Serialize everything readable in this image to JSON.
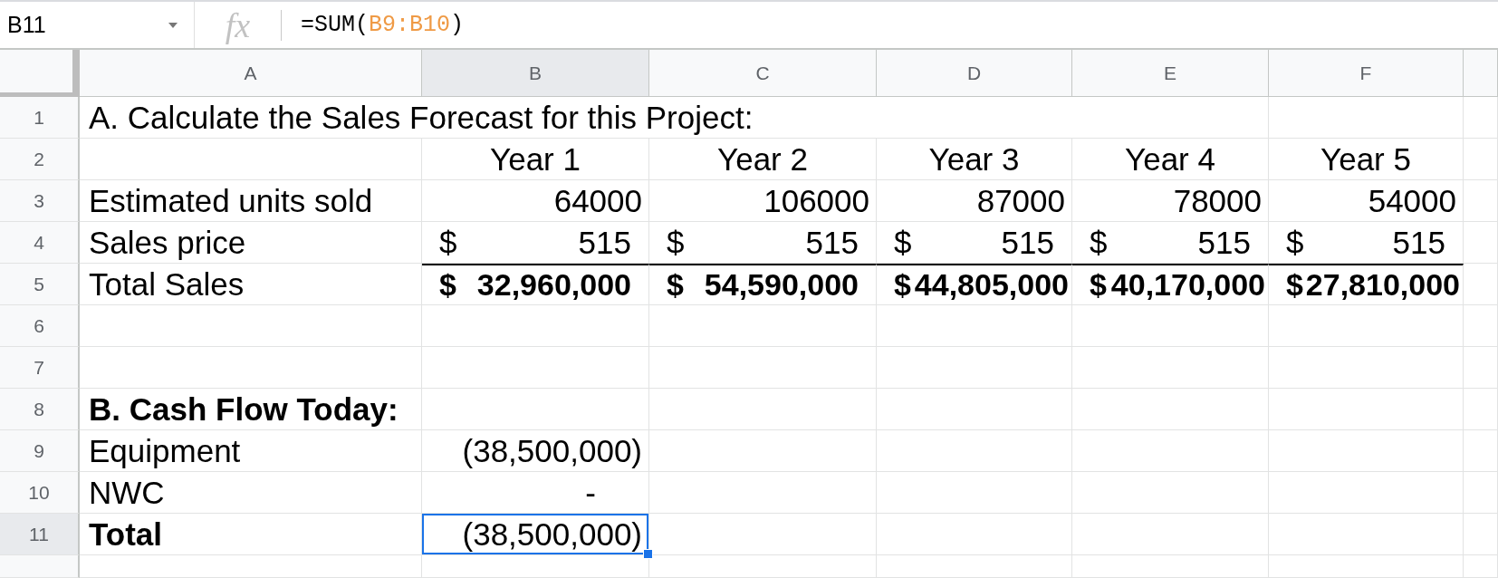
{
  "formula_bar": {
    "name_box": "B11",
    "function_symbol": "fx",
    "formula": [
      {
        "kind": "plain",
        "text": "=SUM("
      },
      {
        "kind": "range",
        "text": "B9:B10"
      },
      {
        "kind": "plain",
        "text": ")"
      }
    ]
  },
  "columns": [
    "A",
    "B",
    "C",
    "D",
    "E",
    "F"
  ],
  "rows": [
    {
      "number": "1",
      "cells": [
        {
          "kind": "label",
          "text": "A. Calculate the Sales Forecast for this Project:",
          "selected": false
        },
        {
          "kind": "merged",
          "selected": false
        },
        {
          "kind": "merged",
          "selected": false
        },
        {
          "kind": "merged",
          "selected": false
        },
        {
          "kind": "merged",
          "selected": false
        },
        {
          "kind": "empty",
          "selected": false
        }
      ]
    },
    {
      "number": "2",
      "cells": [
        {
          "kind": "empty",
          "selected": false
        },
        {
          "kind": "year",
          "text": "Year 1",
          "selected": false
        },
        {
          "kind": "year",
          "text": "Year 2",
          "selected": false
        },
        {
          "kind": "year",
          "text": "Year 3",
          "selected": false
        },
        {
          "kind": "year",
          "text": "Year 4",
          "selected": false
        },
        {
          "kind": "year",
          "text": "Year 5",
          "selected": false
        }
      ]
    },
    {
      "number": "3",
      "cells": [
        {
          "kind": "label",
          "text": "Estimated units sold",
          "selected": false
        },
        {
          "kind": "number",
          "text": "64000",
          "selected": false
        },
        {
          "kind": "number",
          "text": "106000",
          "selected": false
        },
        {
          "kind": "number",
          "text": "87000",
          "selected": false
        },
        {
          "kind": "number",
          "text": "78000",
          "selected": false
        },
        {
          "kind": "number",
          "text": "54000",
          "selected": false
        }
      ]
    },
    {
      "number": "4",
      "cells": [
        {
          "kind": "label",
          "text": "Sales price",
          "selected": false
        },
        {
          "kind": "currency",
          "symbol": "$",
          "amount": "515",
          "selected": false
        },
        {
          "kind": "currency",
          "symbol": "$",
          "amount": "515",
          "selected": false
        },
        {
          "kind": "currency",
          "symbol": "$",
          "amount": "515",
          "selected": false
        },
        {
          "kind": "currency",
          "symbol": "$",
          "amount": "515",
          "selected": false
        },
        {
          "kind": "currency",
          "symbol": "$",
          "amount": "515",
          "selected": false
        }
      ]
    },
    {
      "number": "5",
      "cells": [
        {
          "kind": "label",
          "text": "Total Sales",
          "selected": false
        },
        {
          "kind": "total",
          "symbol": "$",
          "amount": "32,960,000",
          "selected": false
        },
        {
          "kind": "total",
          "symbol": "$",
          "amount": "54,590,000",
          "selected": false
        },
        {
          "kind": "total",
          "symbol": "$",
          "amount": "44,805,000",
          "selected": false
        },
        {
          "kind": "total",
          "symbol": "$",
          "amount": "40,170,000",
          "selected": false
        },
        {
          "kind": "total",
          "symbol": "$",
          "amount": "27,810,000",
          "selected": false
        }
      ]
    },
    {
      "number": "6",
      "cells": [
        {
          "kind": "empty",
          "selected": false
        },
        {
          "kind": "empty",
          "selected": false
        },
        {
          "kind": "empty",
          "selected": false
        },
        {
          "kind": "empty",
          "selected": false
        },
        {
          "kind": "empty",
          "selected": false
        },
        {
          "kind": "empty",
          "selected": false
        }
      ]
    },
    {
      "number": "7",
      "cells": [
        {
          "kind": "empty",
          "selected": false
        },
        {
          "kind": "empty",
          "selected": false
        },
        {
          "kind": "empty",
          "selected": false
        },
        {
          "kind": "empty",
          "selected": false
        },
        {
          "kind": "empty",
          "selected": false
        },
        {
          "kind": "empty",
          "selected": false
        }
      ]
    },
    {
      "number": "8",
      "cells": [
        {
          "kind": "heading",
          "text": "B. Cash Flow Today:",
          "selected": false
        },
        {
          "kind": "empty",
          "selected": false
        },
        {
          "kind": "empty",
          "selected": false
        },
        {
          "kind": "empty",
          "selected": false
        },
        {
          "kind": "empty",
          "selected": false
        },
        {
          "kind": "empty",
          "selected": false
        }
      ]
    },
    {
      "number": "9",
      "cells": [
        {
          "kind": "label",
          "text": "Equipment",
          "selected": false
        },
        {
          "kind": "number",
          "text": "(38,500,000)",
          "selected": false
        },
        {
          "kind": "empty",
          "selected": false
        },
        {
          "kind": "empty",
          "selected": false
        },
        {
          "kind": "empty",
          "selected": false
        },
        {
          "kind": "empty",
          "selected": false
        }
      ]
    },
    {
      "number": "10",
      "cells": [
        {
          "kind": "label",
          "text": "NWC",
          "selected": false
        },
        {
          "kind": "zero",
          "text": "-",
          "selected": false
        },
        {
          "kind": "empty",
          "selected": false
        },
        {
          "kind": "empty",
          "selected": false
        },
        {
          "kind": "empty",
          "selected": false
        },
        {
          "kind": "empty",
          "selected": false
        }
      ]
    },
    {
      "number": "11",
      "cells": [
        {
          "kind": "heading",
          "text": "Total",
          "selected": false
        },
        {
          "kind": "number",
          "text": "(38,500,000)",
          "selected": true
        },
        {
          "kind": "empty",
          "selected": false
        },
        {
          "kind": "empty",
          "selected": false
        },
        {
          "kind": "empty",
          "selected": false
        },
        {
          "kind": "empty",
          "selected": false
        }
      ]
    },
    {
      "cells": [
        {
          "kind": "empty",
          "selected": false
        },
        {
          "kind": "empty",
          "selected": false
        },
        {
          "kind": "empty",
          "selected": false
        },
        {
          "kind": "empty",
          "selected": false
        },
        {
          "kind": "empty",
          "selected": false
        },
        {
          "kind": "empty",
          "selected": false
        }
      ]
    }
  ]
}
